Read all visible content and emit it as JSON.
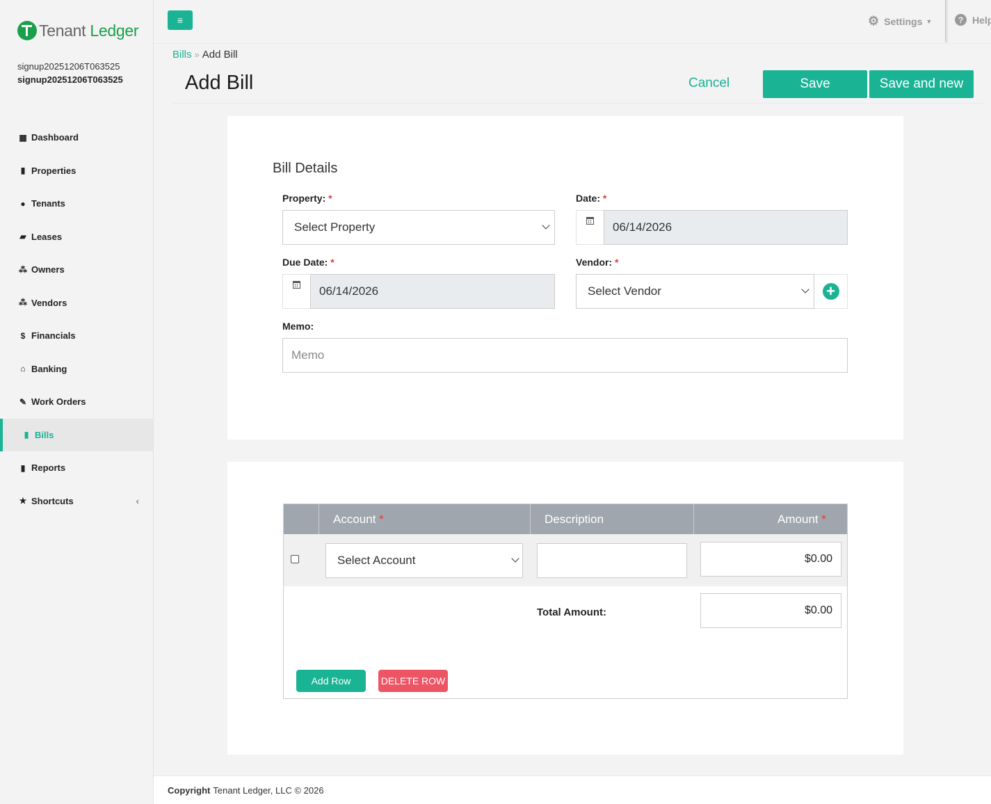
{
  "brand": {
    "name_part1": "Tenant",
    "name_part2": "Ledger"
  },
  "user": {
    "line1": "signup20251206T063525",
    "line2": "signup20251206T063525"
  },
  "nav": [
    {
      "label": "Dashboard",
      "icon": "dashboard-icon"
    },
    {
      "label": "Properties",
      "icon": "building-icon"
    },
    {
      "label": "Tenants",
      "icon": "user-icon"
    },
    {
      "label": "Leases",
      "icon": "folder-open-icon"
    },
    {
      "label": "Owners",
      "icon": "users-icon"
    },
    {
      "label": "Vendors",
      "icon": "users-icon"
    },
    {
      "label": "Financials",
      "icon": "dollar-icon"
    },
    {
      "label": "Banking",
      "icon": "bank-icon"
    },
    {
      "label": "Work Orders",
      "icon": "edit-icon"
    },
    {
      "label": "Bills",
      "icon": "file-icon",
      "active": true
    },
    {
      "label": "Reports",
      "icon": "file-icon"
    },
    {
      "label": "Shortcuts",
      "icon": "star-icon"
    }
  ],
  "topbar": {
    "settings": "Settings",
    "help": "Help"
  },
  "breadcrumb": {
    "parent": "Bills",
    "current": "Add Bill"
  },
  "header": {
    "title": "Add Bill",
    "cancel": "Cancel",
    "save": "Save",
    "save_new": "Save and new"
  },
  "details": {
    "title": "Bill Details",
    "property_label": "Property:",
    "property_value": "Select Property",
    "date_label": "Date:",
    "date_value": "06/14/2026",
    "due_label": "Due Date:",
    "due_value": "06/14/2026",
    "vendor_label": "Vendor:",
    "vendor_value": "Select Vendor",
    "memo_label": "Memo:",
    "memo_placeholder": "Memo",
    "required_mark": "*"
  },
  "lines": {
    "headers": {
      "account": "Account",
      "description": "Description",
      "amount": "Amount"
    },
    "row": {
      "account": "Select Account",
      "description": "",
      "amount": "$0.00"
    },
    "total_label": "Total Amount:",
    "total_value": "$0.00",
    "add_row": "Add Row",
    "delete_row": "DELETE ROW"
  },
  "colors": {
    "accent": "#1ab394",
    "danger": "#ed5565",
    "brand_green": "#1aa04a"
  },
  "footer": {
    "copyright": "Copyright",
    "text": "Tenant Ledger, LLC © 2026"
  }
}
